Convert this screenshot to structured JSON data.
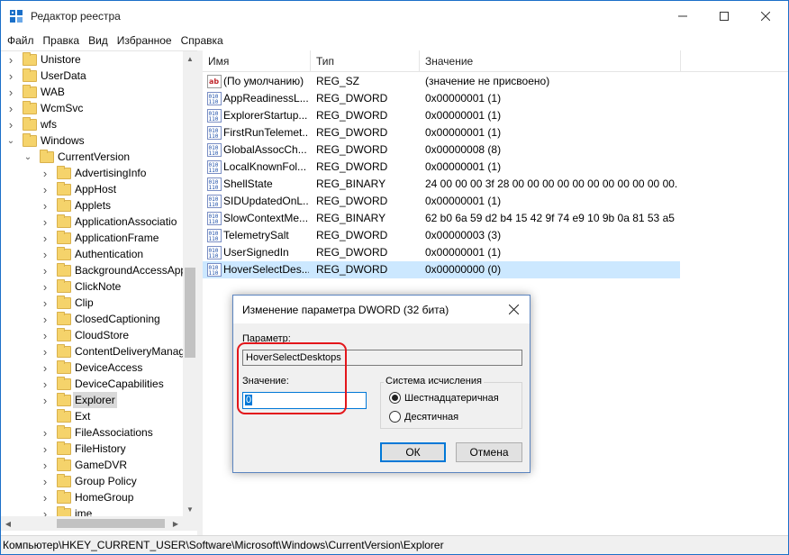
{
  "window": {
    "title": "Редактор реестра",
    "accent_color": "#1b6fc8"
  },
  "menu": [
    "Файл",
    "Правка",
    "Вид",
    "Избранное",
    "Справка"
  ],
  "tree": {
    "items": [
      {
        "label": "Unistore",
        "level": 0,
        "expander": "collapsed"
      },
      {
        "label": "UserData",
        "level": 0,
        "expander": "collapsed"
      },
      {
        "label": "WAB",
        "level": 0,
        "expander": "collapsed"
      },
      {
        "label": "WcmSvc",
        "level": 0,
        "expander": "collapsed"
      },
      {
        "label": "wfs",
        "level": 0,
        "expander": "collapsed"
      },
      {
        "label": "Windows",
        "level": 0,
        "expander": "expanded"
      },
      {
        "label": "CurrentVersion",
        "level": 1,
        "expander": "expanded"
      },
      {
        "label": "AdvertisingInfo",
        "level": 2,
        "expander": "collapsed"
      },
      {
        "label": "AppHost",
        "level": 2,
        "expander": "collapsed"
      },
      {
        "label": "Applets",
        "level": 2,
        "expander": "collapsed"
      },
      {
        "label": "ApplicationAssociatio",
        "level": 2,
        "expander": "collapsed"
      },
      {
        "label": "ApplicationFrame",
        "level": 2,
        "expander": "collapsed"
      },
      {
        "label": "Authentication",
        "level": 2,
        "expander": "collapsed"
      },
      {
        "label": "BackgroundAccessApp",
        "level": 2,
        "expander": "collapsed"
      },
      {
        "label": "ClickNote",
        "level": 2,
        "expander": "collapsed"
      },
      {
        "label": "Clip",
        "level": 2,
        "expander": "collapsed"
      },
      {
        "label": "ClosedCaptioning",
        "level": 2,
        "expander": "collapsed"
      },
      {
        "label": "CloudStore",
        "level": 2,
        "expander": "collapsed"
      },
      {
        "label": "ContentDeliveryManag",
        "level": 2,
        "expander": "collapsed"
      },
      {
        "label": "DeviceAccess",
        "level": 2,
        "expander": "collapsed"
      },
      {
        "label": "DeviceCapabilities",
        "level": 2,
        "expander": "collapsed"
      },
      {
        "label": "Explorer",
        "level": 2,
        "expander": "collapsed",
        "selected": true
      },
      {
        "label": "Ext",
        "level": 2,
        "expander": "none"
      },
      {
        "label": "FileAssociations",
        "level": 2,
        "expander": "collapsed"
      },
      {
        "label": "FileHistory",
        "level": 2,
        "expander": "collapsed"
      },
      {
        "label": "GameDVR",
        "level": 2,
        "expander": "collapsed"
      },
      {
        "label": "Group Policy",
        "level": 2,
        "expander": "collapsed"
      },
      {
        "label": "HomeGroup",
        "level": 2,
        "expander": "collapsed"
      },
      {
        "label": "ime",
        "level": 2,
        "expander": "collapsed"
      }
    ]
  },
  "list": {
    "columns": [
      "Имя",
      "Тип",
      "Значение"
    ],
    "rows": [
      {
        "icon": "string-value-icon",
        "name": "(По умолчанию)",
        "type": "REG_SZ",
        "value": "(значение не присвоено)"
      },
      {
        "icon": "binary-value-icon",
        "name": "AppReadinessL...",
        "type": "REG_DWORD",
        "value": "0x00000001 (1)"
      },
      {
        "icon": "binary-value-icon",
        "name": "ExplorerStartup...",
        "type": "REG_DWORD",
        "value": "0x00000001 (1)"
      },
      {
        "icon": "binary-value-icon",
        "name": "FirstRunTelemet...",
        "type": "REG_DWORD",
        "value": "0x00000001 (1)"
      },
      {
        "icon": "binary-value-icon",
        "name": "GlobalAssocCh...",
        "type": "REG_DWORD",
        "value": "0x00000008 (8)"
      },
      {
        "icon": "binary-value-icon",
        "name": "LocalKnownFol...",
        "type": "REG_DWORD",
        "value": "0x00000001 (1)"
      },
      {
        "icon": "binary-value-icon",
        "name": "ShellState",
        "type": "REG_BINARY",
        "value": "24 00 00 00 3f 28 00 00 00 00 00 00 00 00 00 00 00..."
      },
      {
        "icon": "binary-value-icon",
        "name": "SIDUpdatedOnL...",
        "type": "REG_DWORD",
        "value": "0x00000001 (1)"
      },
      {
        "icon": "binary-value-icon",
        "name": "SlowContextMe...",
        "type": "REG_BINARY",
        "value": "62 b0 6a 59 d2 b4 15 42 9f 74 e9 10 9b 0a 81 53 a5 0..."
      },
      {
        "icon": "binary-value-icon",
        "name": "TelemetrySalt",
        "type": "REG_DWORD",
        "value": "0x00000003 (3)"
      },
      {
        "icon": "binary-value-icon",
        "name": "UserSignedIn",
        "type": "REG_DWORD",
        "value": "0x00000001 (1)"
      },
      {
        "icon": "binary-value-icon",
        "name": "HoverSelectDes...",
        "type": "REG_DWORD",
        "value": "0x00000000 (0)",
        "selected": true
      }
    ]
  },
  "status": {
    "path": "Компьютер\\HKEY_CURRENT_USER\\Software\\Microsoft\\Windows\\CurrentVersion\\Explorer"
  },
  "dialog": {
    "title": "Изменение параметра DWORD (32 бита)",
    "param_label": "Параметр:",
    "param_value": "HoverSelectDesktops",
    "value_label": "Значение:",
    "value": "0",
    "base_group_label": "Система исчисления",
    "base_options": [
      {
        "label": "Шестнадцатеричная",
        "checked": true
      },
      {
        "label": "Десятичная",
        "checked": false
      }
    ],
    "ok_label": "ОК",
    "cancel_label": "Отмена"
  },
  "annotation_color": "#e3161b"
}
